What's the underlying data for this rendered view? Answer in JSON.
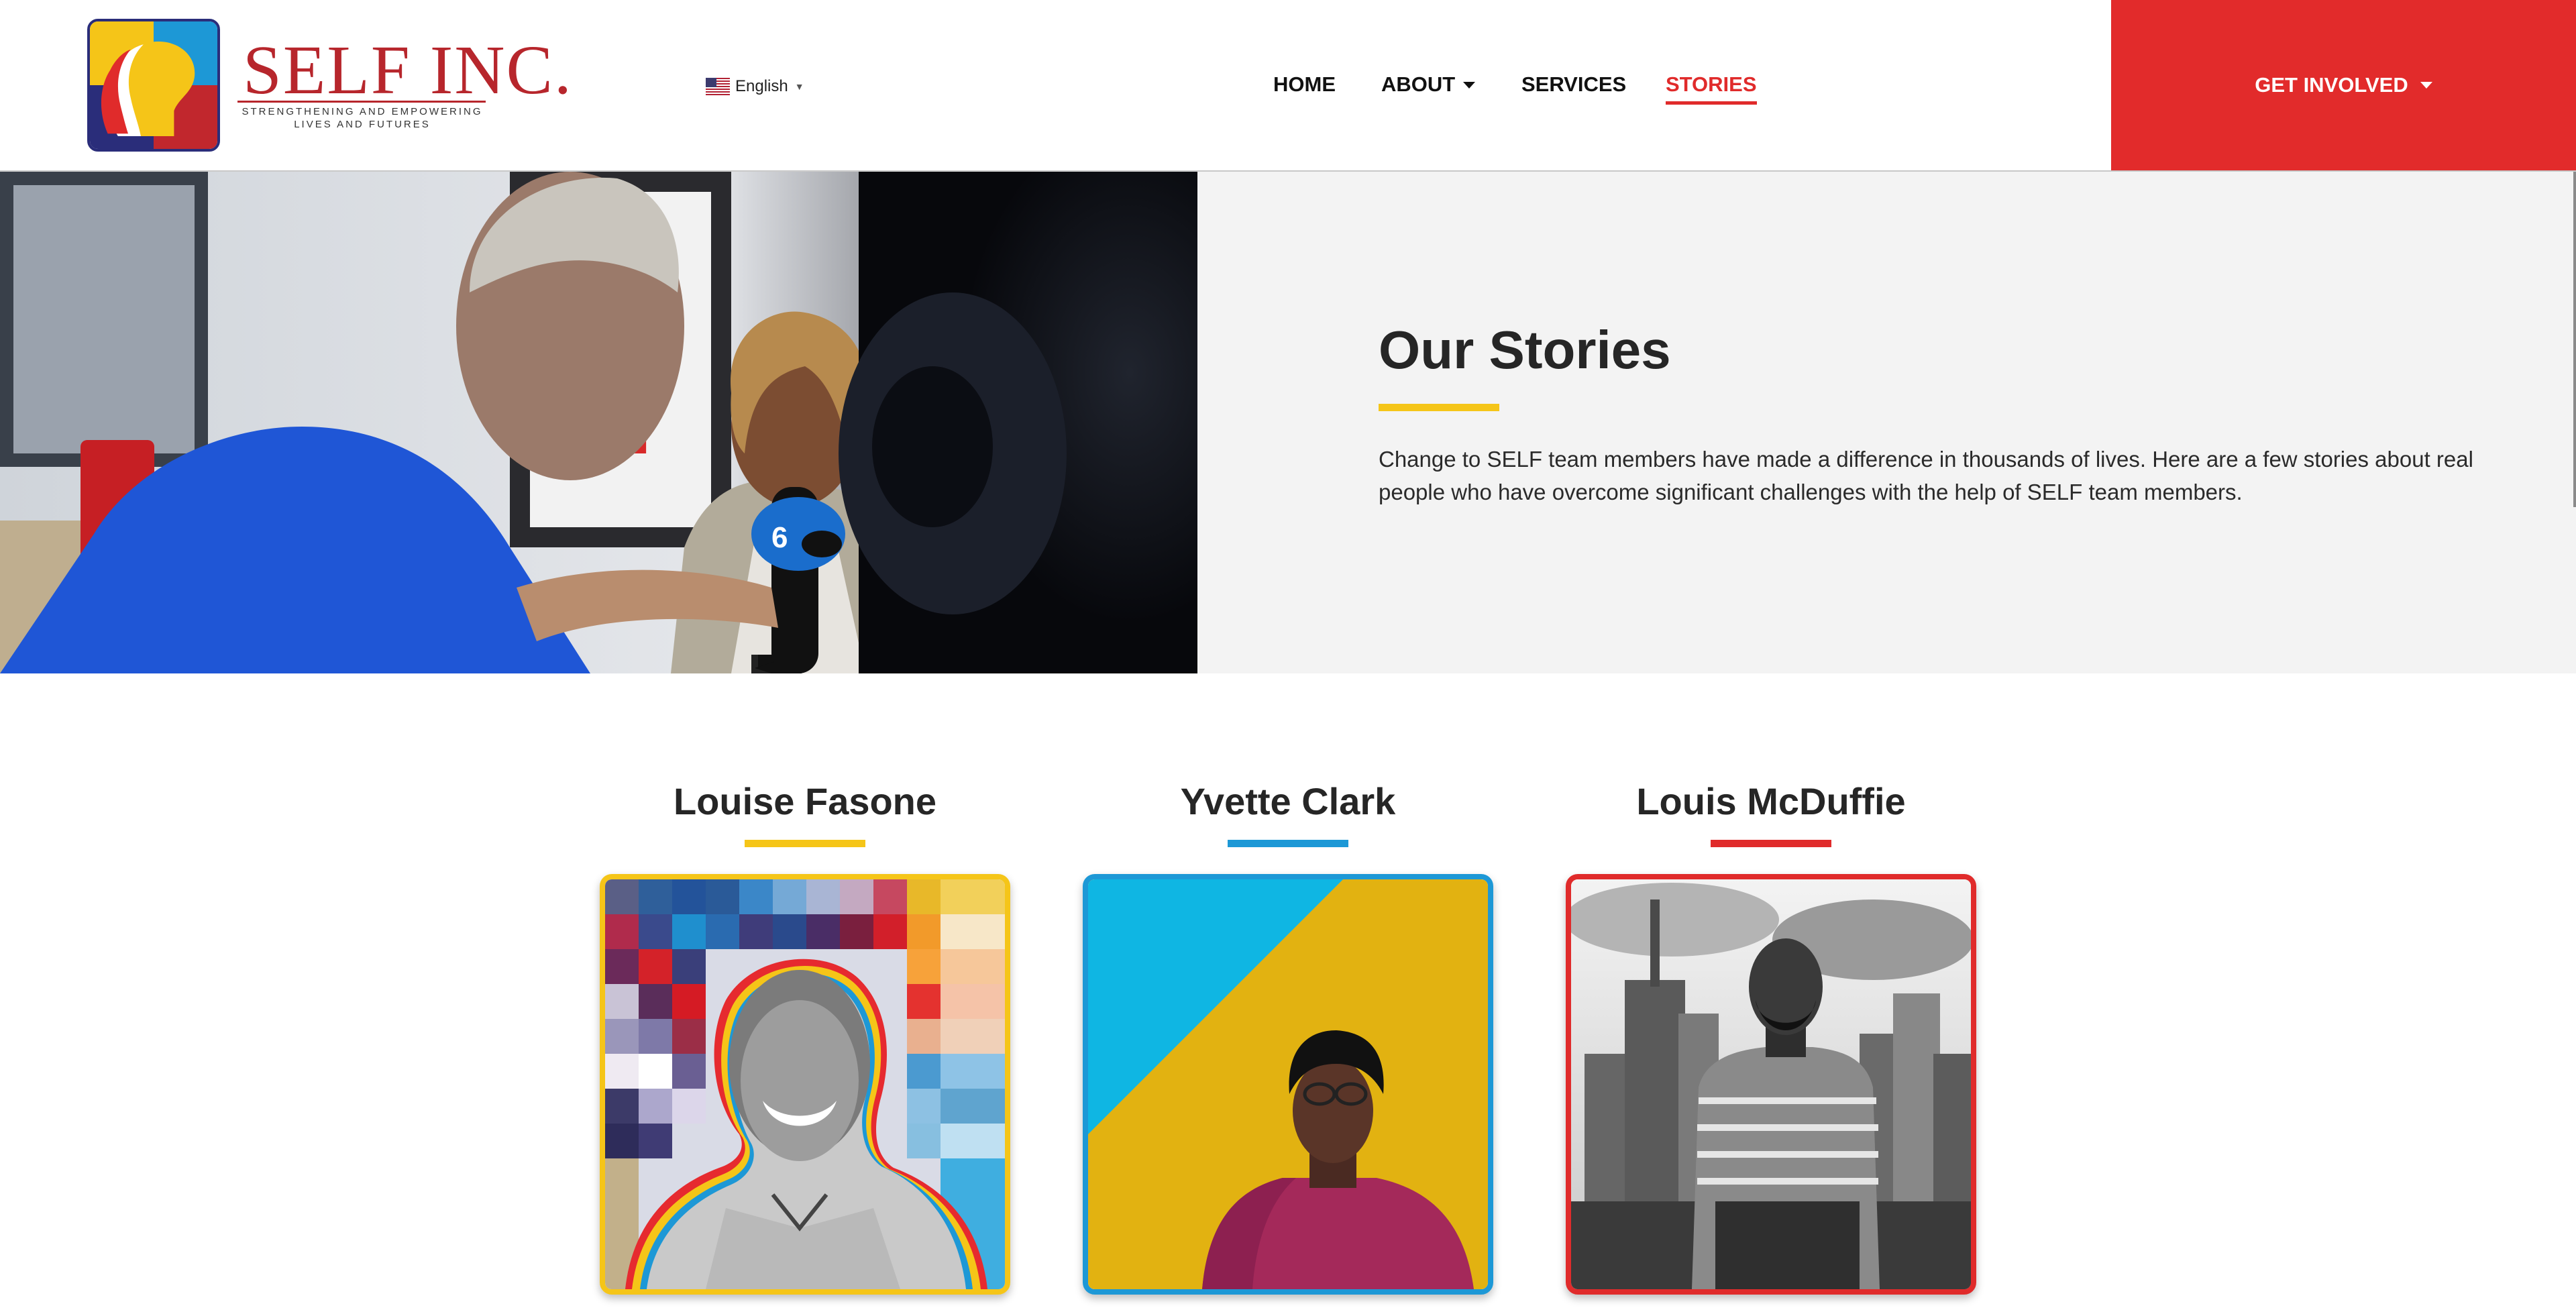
{
  "header": {
    "brand": {
      "name": "SELF INC.",
      "tagline_line1": "STRENGTHENING AND EMPOWERING",
      "tagline_line2": "LIVES AND FUTURES"
    },
    "language": {
      "selected": "English",
      "flag_icon": "us-flag-icon"
    },
    "nav": [
      {
        "label": "HOME",
        "active": false
      },
      {
        "label": "ABOUT",
        "active": false,
        "has_dropdown": true
      },
      {
        "label": "SERVICES",
        "active": false
      },
      {
        "label": "STORIES",
        "active": true
      }
    ],
    "cta": {
      "label": "GET INVOLVED",
      "has_dropdown": true
    }
  },
  "hero": {
    "title": "Our Stories",
    "body": "Change to SELF team members have made a difference in thousands of lives. Here are a few stories about real people who have overcome significant challenges with the help of SELF team members."
  },
  "stories": [
    {
      "name": "Louise Fasone",
      "accent": "#f5c518"
    },
    {
      "name": "Yvette Clark",
      "accent": "#1d98d6"
    },
    {
      "name": "Louis McDuffie",
      "accent": "#e02b2b"
    }
  ],
  "colors": {
    "brand_red": "#e22b2b",
    "brand_yellow": "#f5c518",
    "brand_blue": "#1d98d6",
    "hero_panel_bg": "#f3f3f3"
  }
}
